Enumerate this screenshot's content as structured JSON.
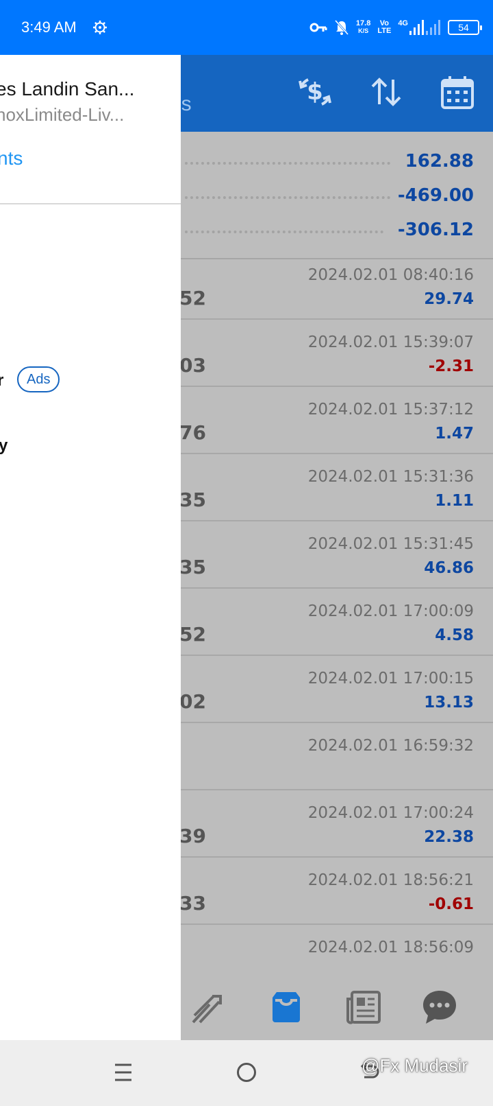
{
  "status_bar": {
    "time": "3:49 AM",
    "network_speed_top": "17.8",
    "network_speed_bottom": "K/S",
    "volte_top": "Vo",
    "volte_bottom": "LTE",
    "signal_type": "4G",
    "battery": "54"
  },
  "header": {
    "title_fragment": "ls"
  },
  "summary": [
    {
      "value": "162.88"
    },
    {
      "value": "-469.00"
    },
    {
      "value": "-306.12"
    }
  ],
  "deals": [
    {
      "id_fragment": "52",
      "datetime": "2024.02.01 08:40:16",
      "profit": "29.74",
      "sign": "pos"
    },
    {
      "id_fragment": "03",
      "datetime": "2024.02.01 15:39:07",
      "profit": "-2.31",
      "sign": "neg"
    },
    {
      "id_fragment": "76",
      "datetime": "2024.02.01 15:37:12",
      "profit": "1.47",
      "sign": "pos"
    },
    {
      "id_fragment": "35",
      "datetime": "2024.02.01 15:31:36",
      "profit": "1.11",
      "sign": "pos"
    },
    {
      "id_fragment": "35",
      "datetime": "2024.02.01 15:31:45",
      "profit": "46.86",
      "sign": "pos"
    },
    {
      "id_fragment": "52",
      "datetime": "2024.02.01 17:00:09",
      "profit": "4.58",
      "sign": "pos"
    },
    {
      "id_fragment": "02",
      "datetime": "2024.02.01 17:00:15",
      "profit": "13.13",
      "sign": "pos"
    },
    {
      "id_fragment": "",
      "datetime": "2024.02.01 16:59:32",
      "profit": "",
      "sign": "pos"
    },
    {
      "id_fragment": "39",
      "datetime": "2024.02.01 17:00:24",
      "profit": "22.38",
      "sign": "pos"
    },
    {
      "id_fragment": "33",
      "datetime": "2024.02.01 18:56:21",
      "profit": "-0.61",
      "sign": "neg"
    },
    {
      "id_fragment": "",
      "datetime": "2024.02.01 18:56:09",
      "profit": "",
      "sign": "pos"
    }
  ],
  "drawer": {
    "account_name": "es Landin San...",
    "account_server": "noxLimited-Liv...",
    "accounts_link": "nts",
    "menu_item_trader": "r",
    "ads_badge": "Ads",
    "menu_item_y": "y"
  },
  "tabs": [
    {
      "icon": "chart-trend-icon"
    },
    {
      "icon": "inbox-icon"
    },
    {
      "icon": "news-icon"
    },
    {
      "icon": "chat-icon"
    }
  ],
  "watermark": "@Fx Mudasir",
  "colors": {
    "status_bar": "#0077ff",
    "header": "#1565c0",
    "positive": "#0d47a1",
    "negative": "#a00000",
    "link": "#2196f3"
  }
}
